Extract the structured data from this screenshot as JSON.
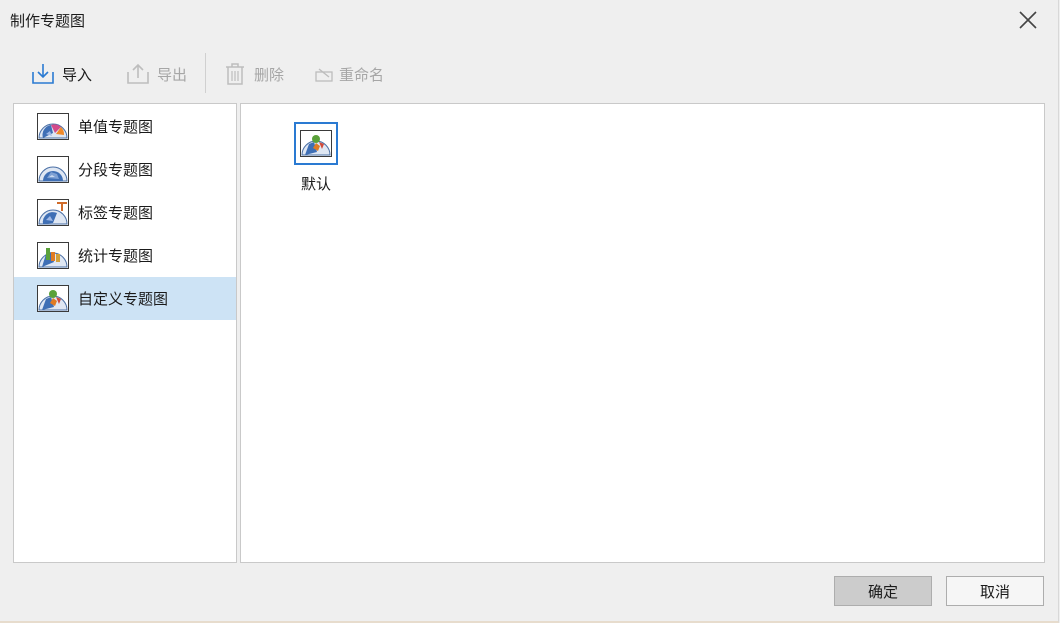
{
  "window": {
    "title": "制作专题图"
  },
  "toolbar": {
    "import_label": "导入",
    "export_label": "导出",
    "delete_label": "删除",
    "rename_label": "重命名"
  },
  "categories": [
    {
      "label": "单值专题图",
      "icon": "unique-value-map-icon"
    },
    {
      "label": "分段专题图",
      "icon": "range-map-icon"
    },
    {
      "label": "标签专题图",
      "icon": "label-map-icon"
    },
    {
      "label": "统计专题图",
      "icon": "statistics-map-icon"
    },
    {
      "label": "自定义专题图",
      "icon": "custom-map-icon",
      "selected": true
    }
  ],
  "templates": [
    {
      "label": "默认",
      "icon": "custom-map-icon",
      "selected": true
    }
  ],
  "footer": {
    "ok_label": "确定",
    "cancel_label": "取消"
  },
  "colors": {
    "selection_bg": "#cde3f5",
    "selection_border": "#2a7ad2"
  }
}
